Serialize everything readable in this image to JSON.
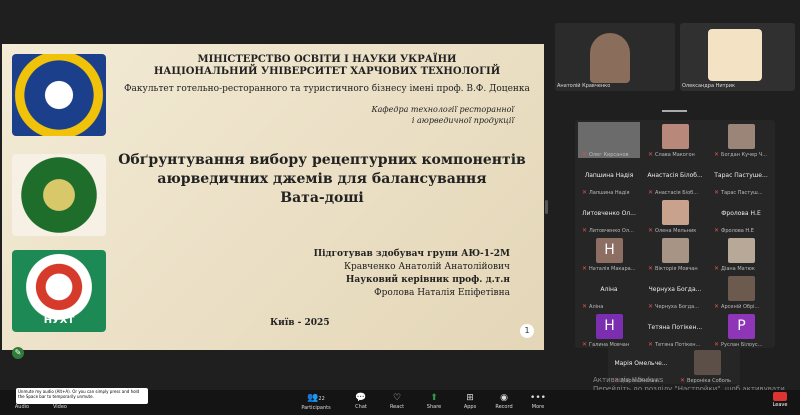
{
  "slide": {
    "ministry_line1": "МІНІСТЕРСТВО ОСВІТИ І НАУКИ УКРАЇНИ",
    "ministry_line2": "НАЦІОНАЛЬНИЙ УНІВЕРСИТЕТ ХАРЧОВИХ ТЕХНОЛОГІЙ",
    "faculty": "Факультет готельно-ресторанного та туристичного бізнесу імені проф. В.Ф. Доценка",
    "kafedra_line1": "Кафедра технології ресторанної",
    "kafedra_line2": "і аюрведичної продукції",
    "title_line1": "Обґрунтування вибору рецептурних компонентів",
    "title_line2": "аюрведичних джемів для балансування",
    "title_line3": "Вата-доші",
    "prepared": "Підготував здобувач групи АЮ-1-2М",
    "student": "Кравченко Анатолій Анатолійович",
    "supervisor_label": "Науковий керівник проф. д.т.н",
    "supervisor": "Фролова Наталія Епіфетівна",
    "city_year": "Київ - 2025",
    "page": "1",
    "logo3_text": "НУХТ"
  },
  "top_tiles": [
    {
      "name": "Анатолій Кравченко"
    },
    {
      "name": "Олександра Нитрик"
    }
  ],
  "grid": [
    {
      "name": "",
      "sub": "Олег Кирсанов"
    },
    {
      "name": "",
      "sub": "Слава Макогон"
    },
    {
      "name": "",
      "sub": "Богдан Кучер Ч..."
    },
    {
      "name": "Лапшина Надія",
      "sub": "Лапшина Надія"
    },
    {
      "name": "Анастасія Білоб...",
      "sub": "Анастасія Біоб..."
    },
    {
      "name": "Тарас Пастуше...",
      "sub": "Тарас Пастуш..."
    },
    {
      "name": "Литовченко Ол...",
      "sub": "Литовченко Ол..."
    },
    {
      "name": "",
      "sub": "Олена Мельник"
    },
    {
      "name": "Фролова Н.Е",
      "sub": "Фролова Н.Е"
    },
    {
      "name": "",
      "sub": "Наталія Макара..."
    },
    {
      "name": "",
      "sub": "Вікторія Мовчан"
    },
    {
      "name": "",
      "sub": "Діана Матюк"
    },
    {
      "name": "Аліна",
      "sub": "Аліна"
    },
    {
      "name": "Чернуха Богда...",
      "sub": "Чернуха Богда..."
    },
    {
      "name": "",
      "sub": "Арсеній Обрі..."
    },
    {
      "name": "",
      "sub": "Галина Мовчан"
    },
    {
      "name": "Тетяна Потікен...",
      "sub": "Тетяна Потікен..."
    },
    {
      "name": "",
      "sub": "Руслан Білоус..."
    }
  ],
  "bottom_tiles": [
    {
      "name": "Марія Омельче...",
      "sub": "Марія Омельч..."
    },
    {
      "name": "",
      "sub": "Вероніка Соболь"
    }
  ],
  "watermark": {
    "line1": "Активація Windows",
    "line2": "Перейдіть до розділу \"Настройки\", щоб активувати Windows."
  },
  "toolbar": {
    "tooltip": "Unmute my audio (Alt+A). Or you can simply press and hold the Space bar to temporarily unmute.",
    "audio": "Audio",
    "video": "Video",
    "participants": "Participants",
    "participants_count": "22",
    "chat": "Chat",
    "react": "React",
    "share": "Share",
    "apps": "Apps",
    "record": "Record",
    "more": "More",
    "leave": "Leave"
  },
  "colors": {
    "slide_bg": "#ece3cc",
    "toolbar_bg": "#141414",
    "leave": "#dd3333",
    "share": "#2e9b4a"
  }
}
